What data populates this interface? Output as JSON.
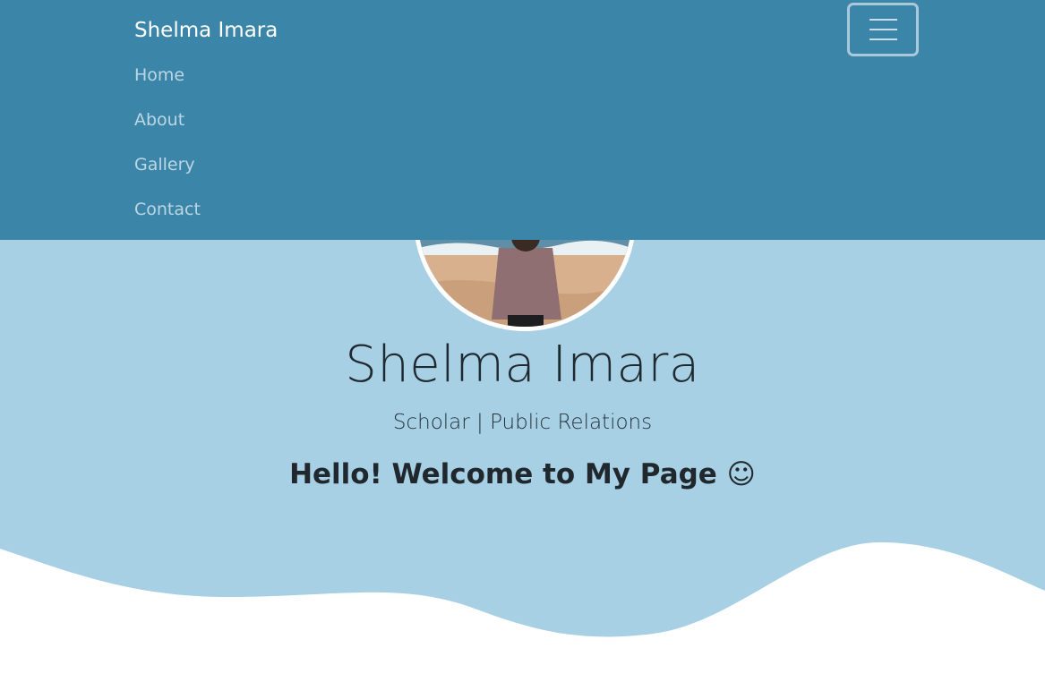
{
  "navbar": {
    "brand": "Shelma Imara",
    "items": [
      {
        "label": "Home"
      },
      {
        "label": "About"
      },
      {
        "label": "Gallery"
      },
      {
        "label": "Contact"
      }
    ],
    "toggler_icon": "hamburger-menu-icon"
  },
  "hero": {
    "name": "Shelma Imara",
    "subtitle": "Scholar | Public Relations",
    "welcome": "Hello! Welcome to My Page ☺",
    "avatar_icon": "profile-photo"
  },
  "colors": {
    "navbar_bg": "#3b86a8",
    "hero_bg": "#a8d0e5",
    "wave": "#ffffff"
  }
}
